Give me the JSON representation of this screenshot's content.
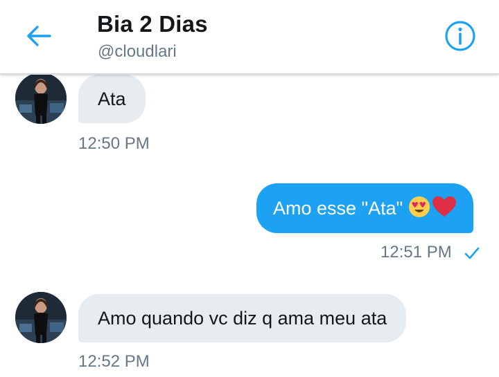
{
  "header": {
    "title": "Bia 2 Dias",
    "handle": "@cloudlari"
  },
  "messages": [
    {
      "direction": "received",
      "text": "Ata",
      "time": "12:50 PM"
    },
    {
      "direction": "sent",
      "text": "Amo esse \"Ata\"",
      "emoji": [
        "heart-eyes-emoji",
        "red-heart-emoji"
      ],
      "time": "12:51 PM",
      "status": "read-check"
    },
    {
      "direction": "received",
      "text": "Amo quando vc diz q ama meu ata",
      "time": "12:52 PM"
    }
  ],
  "icons": {
    "back": "arrow-left-icon",
    "info": "info-circle-icon",
    "check": "check-icon"
  },
  "colors": {
    "accent": "#1da1f2",
    "received_bubble": "#e6ecf0",
    "secondary_text": "#657786"
  }
}
